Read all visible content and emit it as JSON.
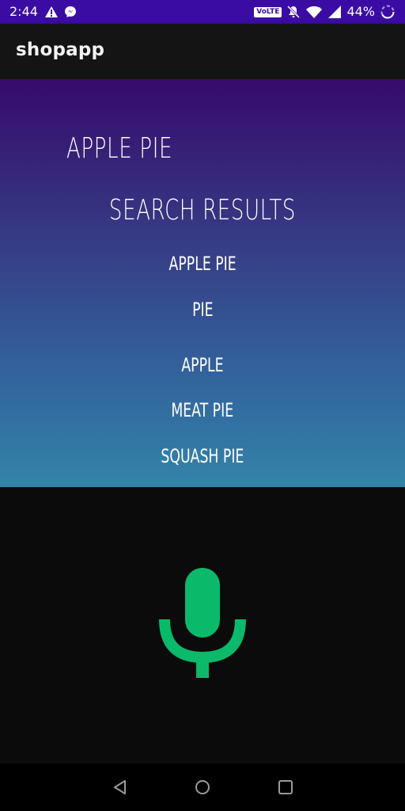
{
  "status_bar": {
    "time": "2:44",
    "volte": "VoLTE",
    "battery": "44%",
    "icons": [
      "warning-icon",
      "messenger-icon",
      "mute-icon",
      "wifi-icon",
      "signal-icon",
      "battery-icon"
    ]
  },
  "app_bar": {
    "title": "shopapp"
  },
  "search": {
    "query": "APPLE PIE",
    "heading": "SEARCH RESULTS",
    "results": [
      "APPLE PIE",
      "PIE",
      "APPLE",
      "MEAT PIE",
      "SQUASH PIE"
    ]
  },
  "mic": {
    "icon": "microphone-icon",
    "color": "#0aba6a"
  },
  "nav_bar": {
    "icons": [
      "back-icon",
      "home-icon",
      "recents-icon"
    ]
  },
  "colors": {
    "status_bar": "#3a0ca3",
    "app_bar": "#141414",
    "gradient_top": "#360b6b",
    "gradient_bottom": "#3384a9",
    "background": "#0b0b0b"
  }
}
